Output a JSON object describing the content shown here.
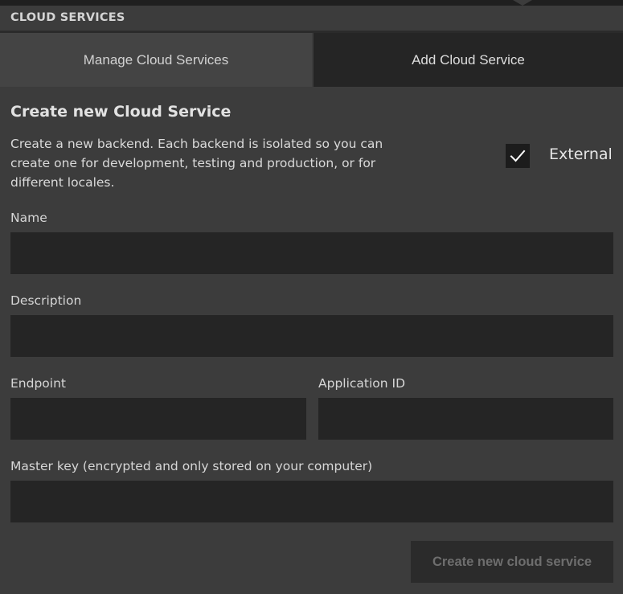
{
  "panel": {
    "title": "CLOUD SERVICES"
  },
  "tabs": [
    {
      "label": "Manage Cloud Services",
      "active": false
    },
    {
      "label": "Add Cloud Service",
      "active": true
    }
  ],
  "form": {
    "heading": "Create new Cloud Service",
    "description": "Create a new backend. Each backend is isolated so you can create one for development, testing and production, or for different locales.",
    "external": {
      "label": "External",
      "checked": true,
      "icon": "checkmark-icon"
    },
    "fields": {
      "name": {
        "label": "Name",
        "value": ""
      },
      "description": {
        "label": "Description",
        "value": ""
      },
      "endpoint": {
        "label": "Endpoint",
        "value": ""
      },
      "application_id": {
        "label": "Application ID",
        "value": ""
      },
      "master_key": {
        "label": "Master key (encrypted and only stored on your computer)",
        "value": ""
      }
    },
    "submit_label": "Create new cloud service",
    "submit_enabled": false
  },
  "colors": {
    "background": "#3c3c3c",
    "field_background": "#252525",
    "active_tab": "#252525",
    "inactive_tab": "#444444",
    "disabled_text": "#6e6e6e"
  }
}
